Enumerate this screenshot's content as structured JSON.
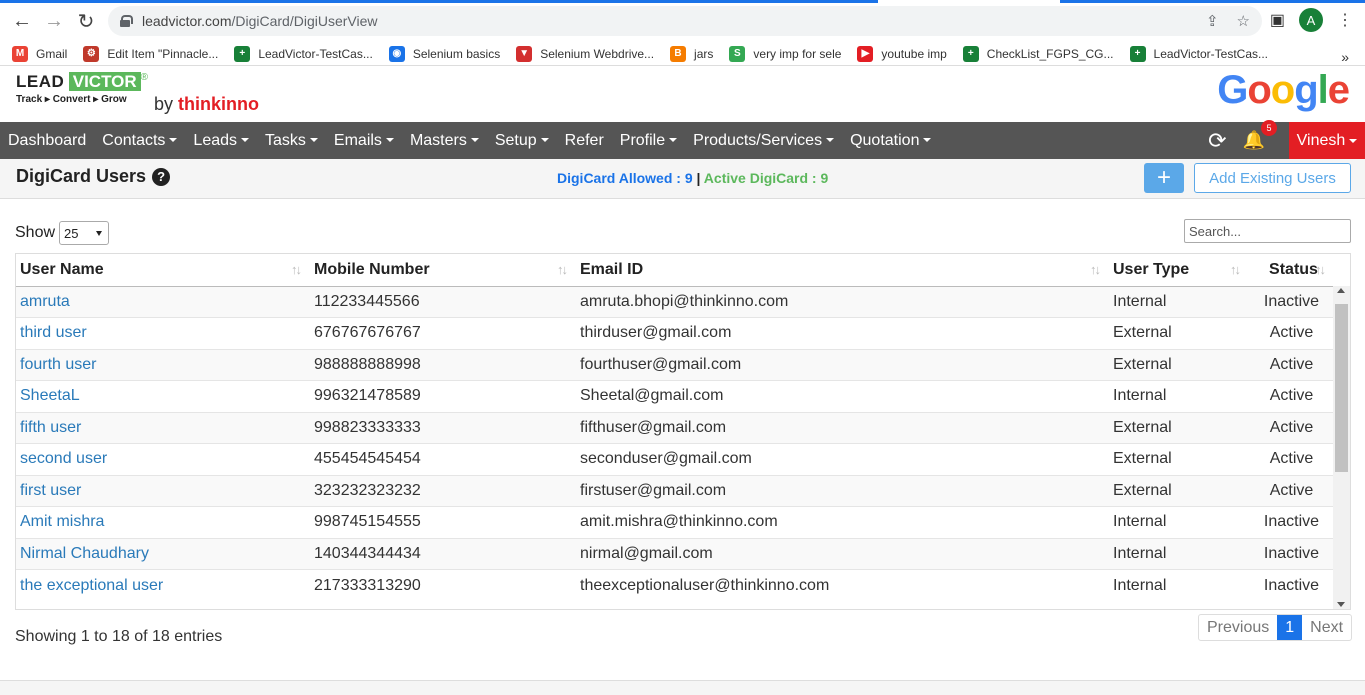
{
  "browser": {
    "url_host": "leadvictor.com",
    "url_path": "/DigiCard/DigiUserView",
    "profile_initial": "A",
    "bookmarks": [
      {
        "label": "Gmail",
        "color": "#ea4335",
        "glyph": "M"
      },
      {
        "label": "Edit Item \"Pinnacle...",
        "color": "#c0392b",
        "glyph": "⚙"
      },
      {
        "label": "LeadVictor-TestCas...",
        "color": "#188038",
        "glyph": "+"
      },
      {
        "label": "Selenium basics",
        "color": "#1a73e8",
        "glyph": "◉"
      },
      {
        "label": "Selenium Webdrive...",
        "color": "#d32f2f",
        "glyph": "▼"
      },
      {
        "label": "jars",
        "color": "#f57c00",
        "glyph": "B"
      },
      {
        "label": "very imp for sele",
        "color": "#34a853",
        "glyph": "S"
      },
      {
        "label": "youtube imp",
        "color": "#e31e24",
        "glyph": "▶"
      },
      {
        "label": "CheckList_FGPS_CG...",
        "color": "#188038",
        "glyph": "+"
      },
      {
        "label": "LeadVictor-TestCas...",
        "color": "#188038",
        "glyph": "+"
      }
    ],
    "more": "»"
  },
  "brand": {
    "lead": "LEAD",
    "victor": "VICTOR",
    "reg": "®",
    "tagline": "Track ▸ Convert ▸ Grow",
    "by": "by",
    "company": "thinkinno",
    "google": "Google"
  },
  "nav": {
    "items": [
      {
        "label": "Dashboard",
        "dropdown": false
      },
      {
        "label": "Contacts",
        "dropdown": true
      },
      {
        "label": "Leads",
        "dropdown": true
      },
      {
        "label": "Tasks",
        "dropdown": true
      },
      {
        "label": "Emails",
        "dropdown": true
      },
      {
        "label": "Masters",
        "dropdown": true
      },
      {
        "label": "Setup",
        "dropdown": true
      },
      {
        "label": "Refer",
        "dropdown": false
      },
      {
        "label": "Profile",
        "dropdown": true
      },
      {
        "label": "Products/Services",
        "dropdown": true
      },
      {
        "label": "Quotation",
        "dropdown": true
      }
    ],
    "notification_count": "5",
    "user_name": "Vinesh"
  },
  "page": {
    "title": "DigiCard Users",
    "allowed_label": "DigiCard Allowed : 9",
    "separator": "|",
    "active_label": "Active DigiCard : 9",
    "add_label": "+",
    "add_existing_label": "Add Existing Users"
  },
  "controls": {
    "show_label": "Show",
    "page_size": "25",
    "search_placeholder": "Search..."
  },
  "table": {
    "columns": [
      "User Name",
      "Mobile Number",
      "Email ID",
      "User Type",
      "Status"
    ],
    "rows": [
      [
        "amruta",
        "112233445566",
        "amruta.bhopi@thinkinno.com",
        "Internal",
        "Inactive"
      ],
      [
        "third user",
        "676767676767",
        "thirduser@gmail.com",
        "External",
        "Active"
      ],
      [
        "fourth user",
        "988888888998",
        "fourthuser@gmail.com",
        "External",
        "Active"
      ],
      [
        "SheetaL",
        "996321478589",
        "Sheetal@gmail.com",
        "Internal",
        "Active"
      ],
      [
        "fifth user",
        "998823333333",
        "fifthuser@gmail.com",
        "External",
        "Active"
      ],
      [
        "second user",
        "455454545454",
        "seconduser@gmail.com",
        "External",
        "Active"
      ],
      [
        "first user",
        "323232323232",
        "firstuser@gmail.com",
        "External",
        "Active"
      ],
      [
        "Amit mishra",
        "998745154555",
        "amit.mishra@thinkinno.com",
        "Internal",
        "Inactive"
      ],
      [
        "Nirmal Chaudhary",
        "140344344434",
        "nirmal@gmail.com",
        "Internal",
        "Inactive"
      ],
      [
        "the exceptional user",
        "217333313290",
        "theexceptionaluser@thinkinno.com",
        "Internal",
        "Inactive"
      ]
    ]
  },
  "footer": {
    "info": "Showing 1 to 18 of 18 entries",
    "previous": "Previous",
    "current_page": "1",
    "next": "Next"
  }
}
